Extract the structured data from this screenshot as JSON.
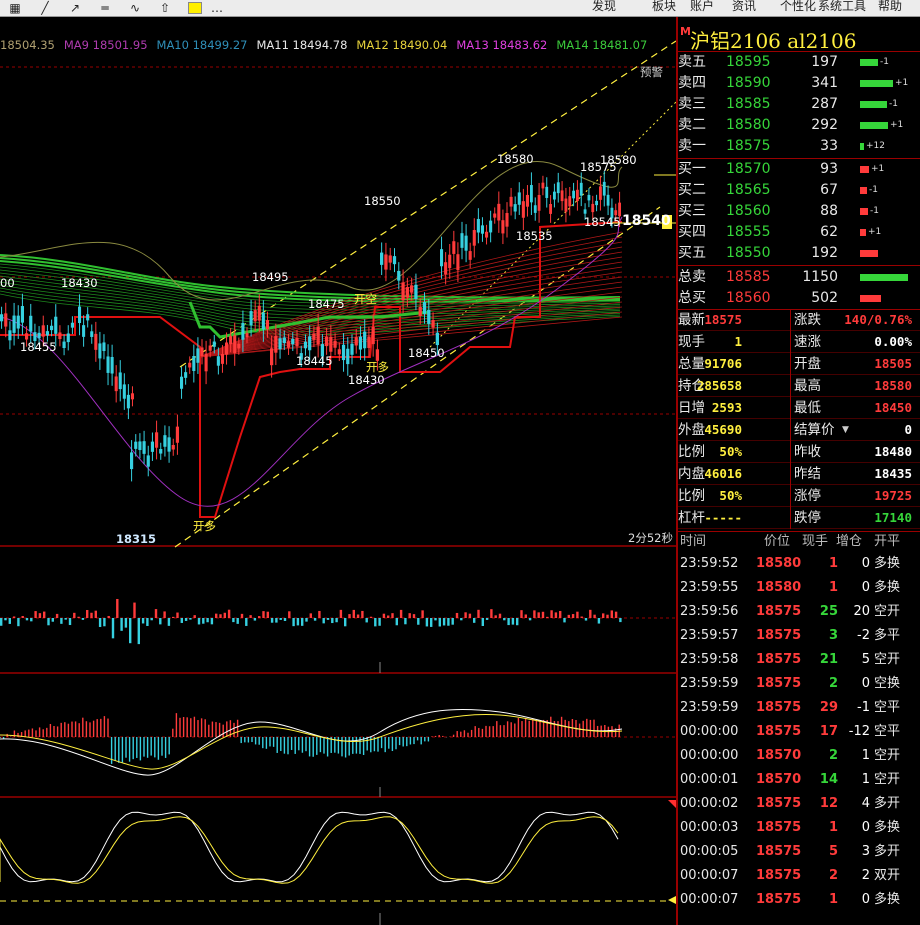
{
  "toolbar": {
    "icons": [
      "grid-icon",
      "line-icon",
      "ray-icon",
      "hline-icon",
      "wave-icon",
      "lock-icon",
      "color-icon",
      "more-icon"
    ],
    "menu": [
      "发现",
      "板块",
      "账户",
      "资讯",
      "个性化",
      "系统工具",
      "帮助"
    ]
  },
  "ma_legend": [
    {
      "label": "18504.35",
      "color": "#b0a070"
    },
    {
      "label": "MA9 18501.95",
      "color": "#b03cb0"
    },
    {
      "label": "MA10 18499.27",
      "color": "#2f8fb8"
    },
    {
      "label": "MA11 18494.78",
      "color": "#e8e8e8"
    },
    {
      "label": "MA12 18490.04",
      "color": "#e8d43c"
    },
    {
      "label": "MA13 18483.62",
      "color": "#e040e0"
    },
    {
      "label": "MA14 18481.07",
      "color": "#3ccc3c"
    }
  ],
  "chart_labels": {
    "warn": "预警",
    "p18580a": "18580",
    "p18575": "18575",
    "p18580b": "18580",
    "p18550": "18550",
    "p18535": "18535",
    "p18545": "18545",
    "p18540": "18540",
    "p18495": "18495",
    "p18475": "18475",
    "open_short": "开空",
    "p18445": "18445",
    "open_long1": "开多",
    "p18430": "18430",
    "p18450": "18450",
    "p00": "00",
    "p18430b": "18430",
    "p18455": "18455",
    "p18315": "18315",
    "open_long2": "开多",
    "timer": "2分52秒"
  },
  "colors": {
    "up": "#ff3b3b",
    "down": "#36d0e0",
    "green": "#36d63a",
    "yellow": "#ffef3f",
    "grid": "#9a0000"
  },
  "title": {
    "marker": "M",
    "text": "沪铝2106  al2106"
  },
  "asks": [
    {
      "label": "卖五",
      "price": "18595",
      "vol": "197",
      "chg": "-1",
      "bar": 0.3
    },
    {
      "label": "卖四",
      "price": "18590",
      "vol": "341",
      "chg": "+1",
      "bar": 0.55
    },
    {
      "label": "卖三",
      "price": "18585",
      "vol": "287",
      "chg": "-1",
      "bar": 0.45
    },
    {
      "label": "卖二",
      "price": "18580",
      "vol": "292",
      "chg": "+1",
      "bar": 0.47
    },
    {
      "label": "卖一",
      "price": "18575",
      "vol": "33",
      "chg": "+12",
      "bar": 0.06
    }
  ],
  "bids": [
    {
      "label": "买一",
      "price": "18570",
      "vol": "93",
      "chg": "+1",
      "bar": 0.15
    },
    {
      "label": "买二",
      "price": "18565",
      "vol": "67",
      "chg": "-1",
      "bar": 0.11
    },
    {
      "label": "买三",
      "price": "18560",
      "vol": "88",
      "chg": "-1",
      "bar": 0.14
    },
    {
      "label": "买四",
      "price": "18555",
      "vol": "62",
      "chg": "+1",
      "bar": 0.1
    },
    {
      "label": "买五",
      "price": "18550",
      "vol": "192",
      "chg": "",
      "bar": 0.3
    }
  ],
  "totals": [
    {
      "label": "总卖",
      "price": "18585",
      "vol": "1150",
      "bar": 0.8,
      "color": "#36d63a"
    },
    {
      "label": "总买",
      "price": "18560",
      "vol": "502",
      "bar": 0.35,
      "color": "#ff3b3b"
    }
  ],
  "stats_left": [
    {
      "k": "最新",
      "v": "18575",
      "c": "red"
    },
    {
      "k": "现手",
      "v": "1",
      "c": "yellow"
    },
    {
      "k": "总量",
      "v": "91706",
      "c": "yellow"
    },
    {
      "k": "持仓",
      "v": "285658",
      "c": "yellow"
    },
    {
      "k": "日增",
      "v": "2593",
      "c": "yellow"
    },
    {
      "k": "外盘",
      "v": "45690",
      "c": "yellow"
    },
    {
      "k": "比例",
      "v": "50%",
      "c": "yellow"
    },
    {
      "k": "内盘",
      "v": "46016",
      "c": "yellow"
    },
    {
      "k": "比例",
      "v": "50%",
      "c": "yellow"
    },
    {
      "k": "杠杆",
      "v": "-----",
      "c": "yellow"
    }
  ],
  "stats_right": [
    {
      "k": "涨跌",
      "v": "140/0.76%",
      "c": "red"
    },
    {
      "k": "速涨",
      "v": "0.00%",
      "c": "white"
    },
    {
      "k": "开盘",
      "v": "18505",
      "c": "red"
    },
    {
      "k": "最高",
      "v": "18580",
      "c": "red"
    },
    {
      "k": "最低",
      "v": "18450",
      "c": "red"
    },
    {
      "k": "结算价",
      "v": "0",
      "c": "white"
    },
    {
      "k": "昨收",
      "v": "18480",
      "c": "white"
    },
    {
      "k": "昨结",
      "v": "18435",
      "c": "white"
    },
    {
      "k": "涨停",
      "v": "19725",
      "c": "red"
    },
    {
      "k": "跌停",
      "v": "17140",
      "c": "green"
    }
  ],
  "ticks_header": [
    "时间",
    "价位",
    "现手",
    "增仓",
    "开平"
  ],
  "ticks": [
    {
      "t": "23:59:52",
      "p": "18580",
      "q": "1",
      "d": "0",
      "type": "多换",
      "qc": "red",
      "tc": "red"
    },
    {
      "t": "23:59:55",
      "p": "18580",
      "q": "1",
      "d": "0",
      "type": "多换",
      "qc": "red",
      "tc": "red"
    },
    {
      "t": "23:59:56",
      "p": "18575",
      "q": "25",
      "d": "20",
      "type": "空开",
      "qc": "green",
      "tc": "green"
    },
    {
      "t": "23:59:57",
      "p": "18575",
      "q": "3",
      "d": "-2",
      "type": "多平",
      "qc": "green",
      "tc": "green"
    },
    {
      "t": "23:59:58",
      "p": "18575",
      "q": "21",
      "d": "5",
      "type": "空开",
      "qc": "green",
      "tc": "green"
    },
    {
      "t": "23:59:59",
      "p": "18575",
      "q": "2",
      "d": "0",
      "type": "空换",
      "qc": "green",
      "tc": "green"
    },
    {
      "t": "23:59:59",
      "p": "18575",
      "q": "29",
      "d": "-1",
      "type": "空平",
      "qc": "red",
      "tc": "red"
    },
    {
      "t": "00:00:00",
      "p": "18575",
      "q": "17",
      "d": "-12",
      "type": "空平",
      "qc": "red",
      "tc": "red"
    },
    {
      "t": "00:00:00",
      "p": "18570",
      "q": "2",
      "d": "1",
      "type": "空开",
      "qc": "green",
      "tc": "green"
    },
    {
      "t": "00:00:01",
      "p": "18570",
      "q": "14",
      "d": "1",
      "type": "空开",
      "qc": "green",
      "tc": "green"
    },
    {
      "t": "00:00:02",
      "p": "18575",
      "q": "12",
      "d": "4",
      "type": "多开",
      "qc": "red",
      "tc": "red"
    },
    {
      "t": "00:00:03",
      "p": "18575",
      "q": "1",
      "d": "0",
      "type": "多换",
      "qc": "red",
      "tc": "red"
    },
    {
      "t": "00:00:05",
      "p": "18575",
      "q": "5",
      "d": "3",
      "type": "多开",
      "qc": "red",
      "tc": "red"
    },
    {
      "t": "00:00:07",
      "p": "18575",
      "q": "2",
      "d": "2",
      "type": "双开",
      "qc": "red",
      "tc": "red"
    },
    {
      "t": "00:00:07",
      "p": "18575",
      "q": "1",
      "d": "0",
      "type": "多换",
      "qc": "red",
      "tc": "red"
    }
  ]
}
